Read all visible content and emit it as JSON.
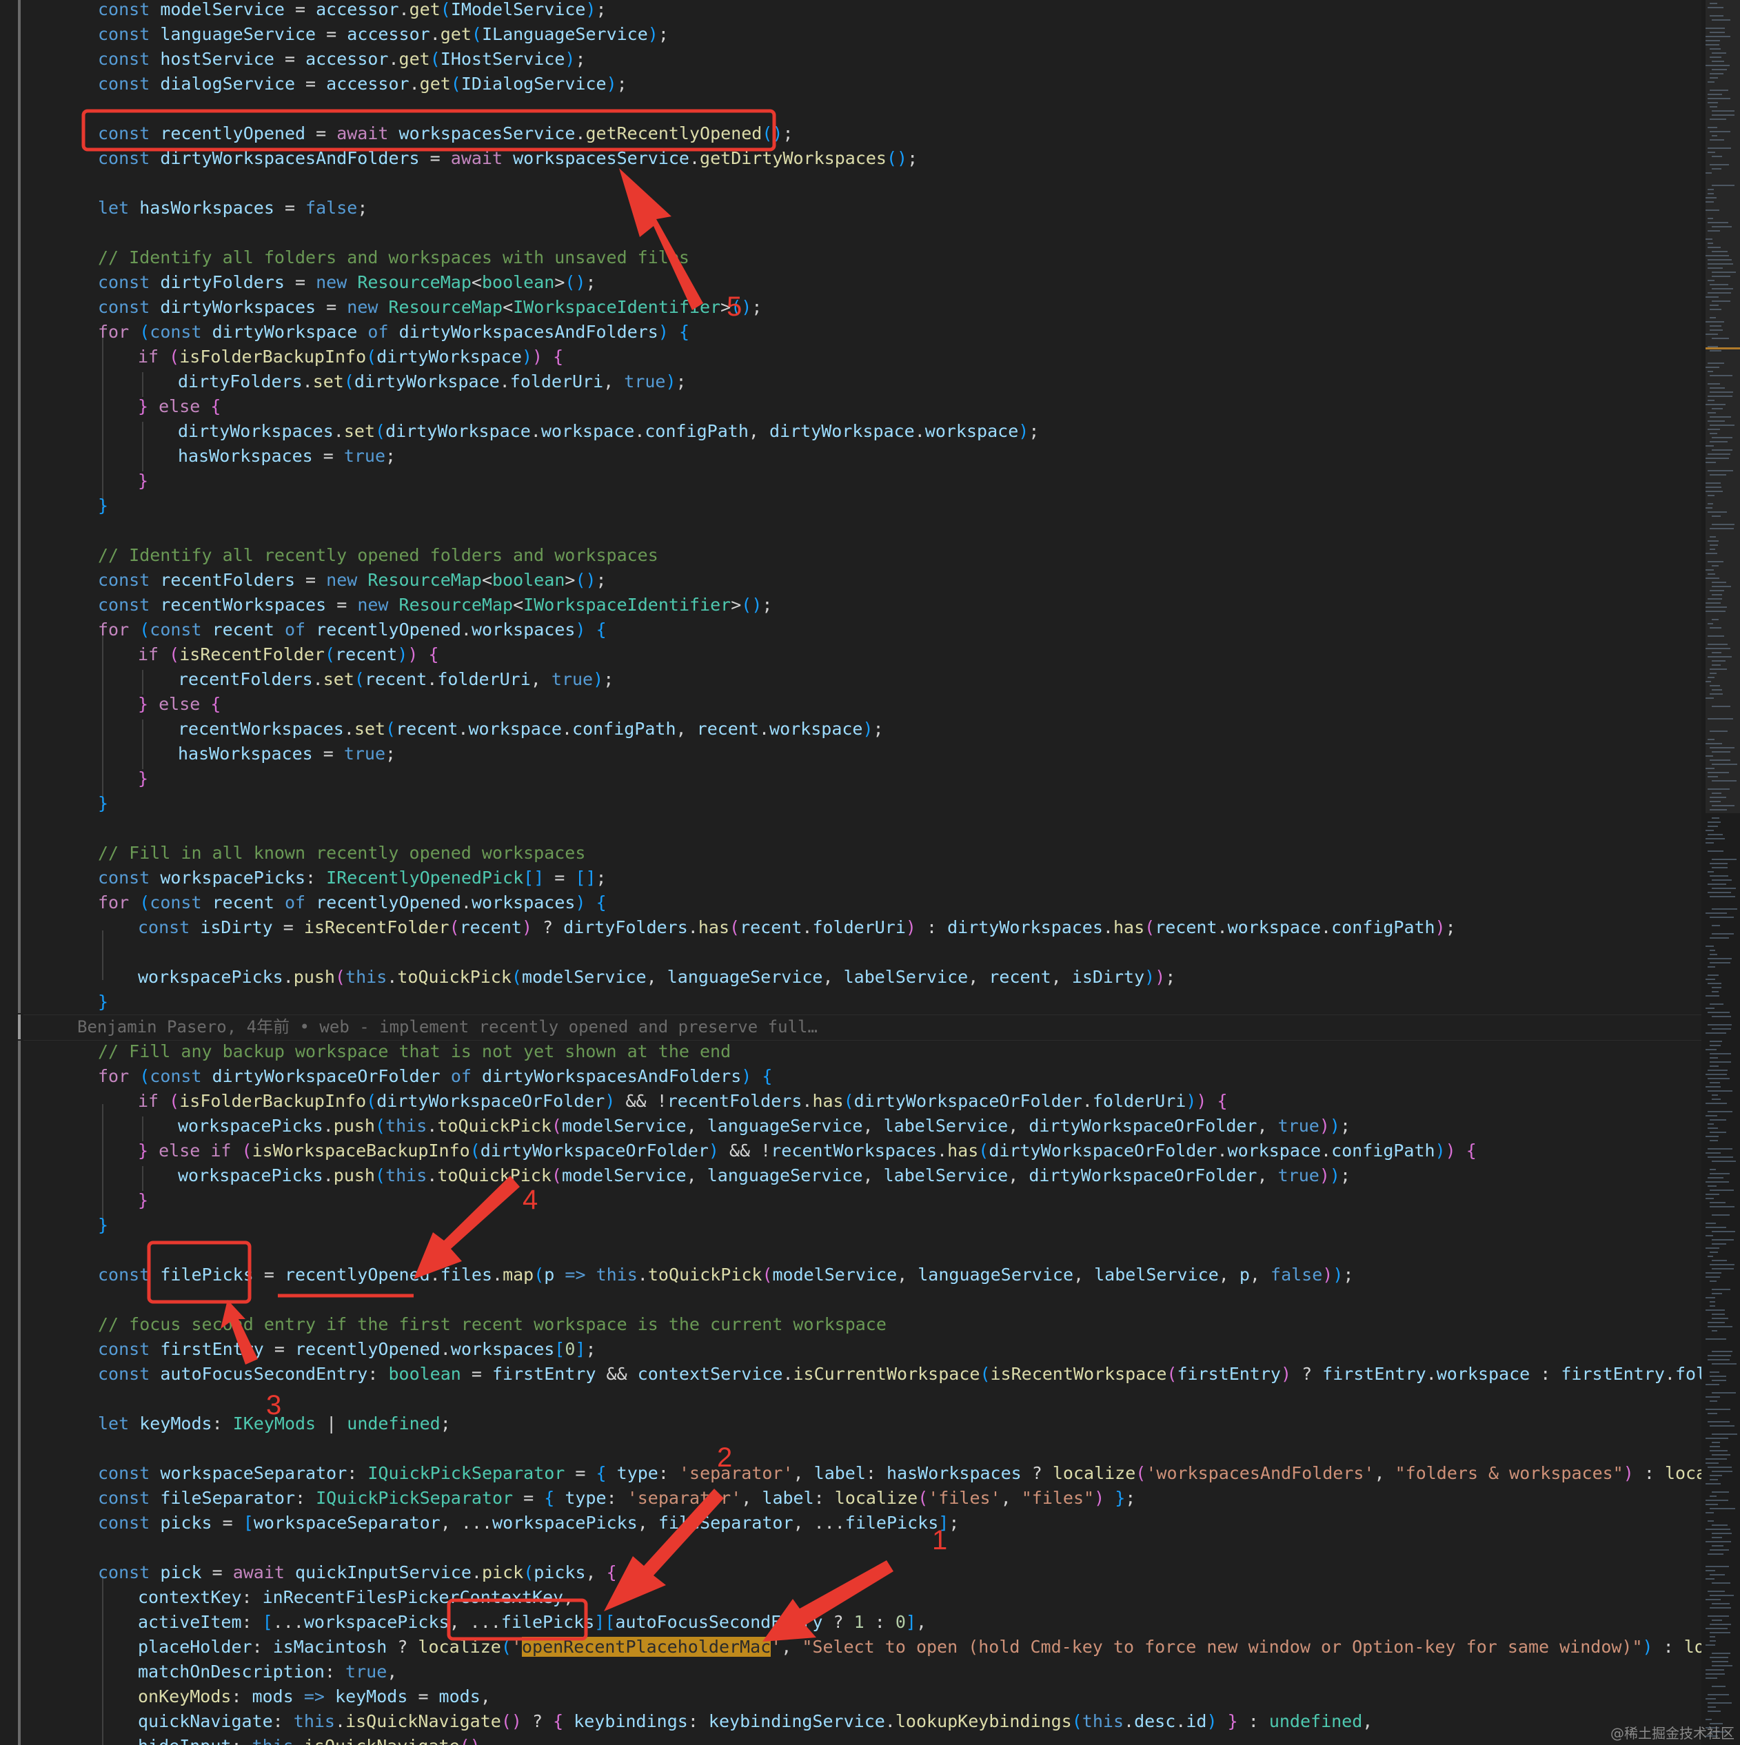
{
  "blame": {
    "author": "Benjamin Pasero, 4年前 • web - implement recently opened and preserve full…"
  },
  "editor": {
    "highlighted_token": "openRecentPlaceholderMac"
  },
  "annotations": {
    "labels": [
      "5",
      "4",
      "3",
      "2",
      "1"
    ],
    "color": "#e8392f"
  },
  "watermark": {
    "text": "@稀土掘金技术社区"
  },
  "minimap": {
    "visible": true
  }
}
